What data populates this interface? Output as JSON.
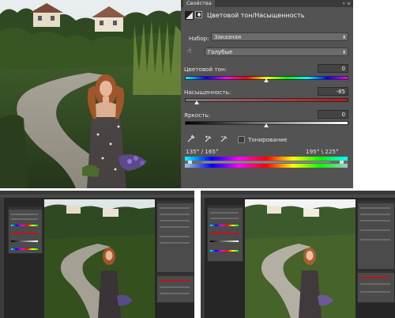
{
  "panel": {
    "tab_title": "Свойства",
    "adjustment_title": "Цветовой тон/Насыщенность",
    "preset_label": "Набор:",
    "preset_value": "Заказная",
    "channel_value": "Голубые",
    "hue_label": "Цветовой тон:",
    "hue_value": "0",
    "saturation_label": "Насыщенность:",
    "saturation_value": "-85",
    "lightness_label": "Яркость:",
    "lightness_value": "0",
    "colorize_label": "Тонирование",
    "range_left": "135° / 165°",
    "range_right": "195° \\ 225°",
    "hue_level": 0.5,
    "saturation_level": 0.075,
    "lightness_level": 0.5
  },
  "colors": {
    "panel_bg": "#535353",
    "header_bg": "#3a3a3a",
    "saturation_track": "#c0141c",
    "app_bg": "#262626"
  }
}
